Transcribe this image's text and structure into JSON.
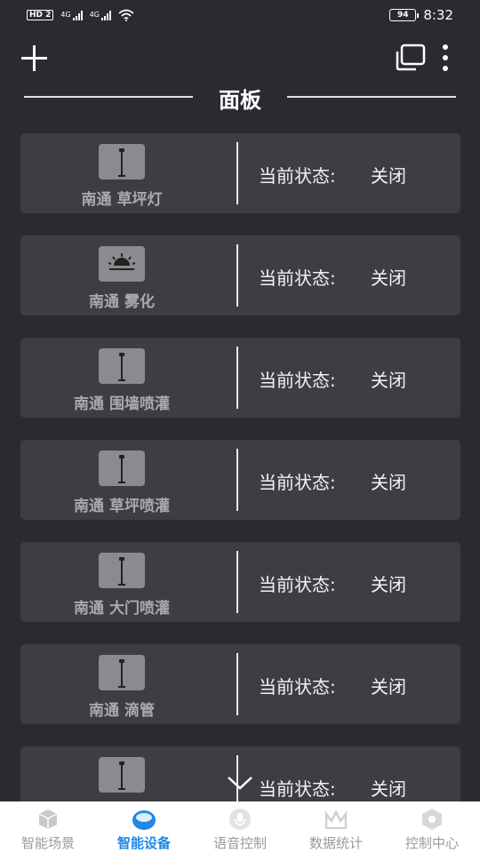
{
  "status_bar": {
    "left_badge": "HD 2",
    "network_1": "4G",
    "network_2": "4G",
    "battery": "94",
    "time": "8:32"
  },
  "toolbar": {
    "add_icon": "plus-icon",
    "copy_icon": "copy-icon",
    "more_icon": "more-vertical-icon"
  },
  "section": {
    "title": "面板"
  },
  "devices": [
    {
      "name": "南通 草坪灯",
      "state_label": "当前状态:",
      "state_value": "关闭",
      "icon": "lamp-post-icon"
    },
    {
      "name": "南通 雾化",
      "state_label": "当前状态:",
      "state_value": "关闭",
      "icon": "sunrise-icon"
    },
    {
      "name": "南通 围墙喷灌",
      "state_label": "当前状态:",
      "state_value": "关闭",
      "icon": "lamp-post-icon"
    },
    {
      "name": "南通 草坪喷灌",
      "state_label": "当前状态:",
      "state_value": "关闭",
      "icon": "lamp-post-icon"
    },
    {
      "name": "南通 大门喷灌",
      "state_label": "当前状态:",
      "state_value": "关闭",
      "icon": "lamp-post-icon"
    },
    {
      "name": "南通 滴管",
      "state_label": "当前状态:",
      "state_value": "关闭",
      "icon": "lamp-post-icon"
    },
    {
      "name": "",
      "state_label": "当前状态:",
      "state_value": "关闭",
      "icon": "lamp-post-icon"
    }
  ],
  "tabs": [
    {
      "label": "智能场景",
      "icon": "cube-icon",
      "active": false
    },
    {
      "label": "智能设备",
      "icon": "device-icon",
      "active": true
    },
    {
      "label": "语音控制",
      "icon": "microphone-icon",
      "active": false
    },
    {
      "label": "数据统计",
      "icon": "chart-icon",
      "active": false
    },
    {
      "label": "控制中心",
      "icon": "hexagon-icon",
      "active": false
    }
  ],
  "colors": {
    "accent": "#1e88e5",
    "background": "#2a2a30",
    "card": "#3d3d44"
  }
}
